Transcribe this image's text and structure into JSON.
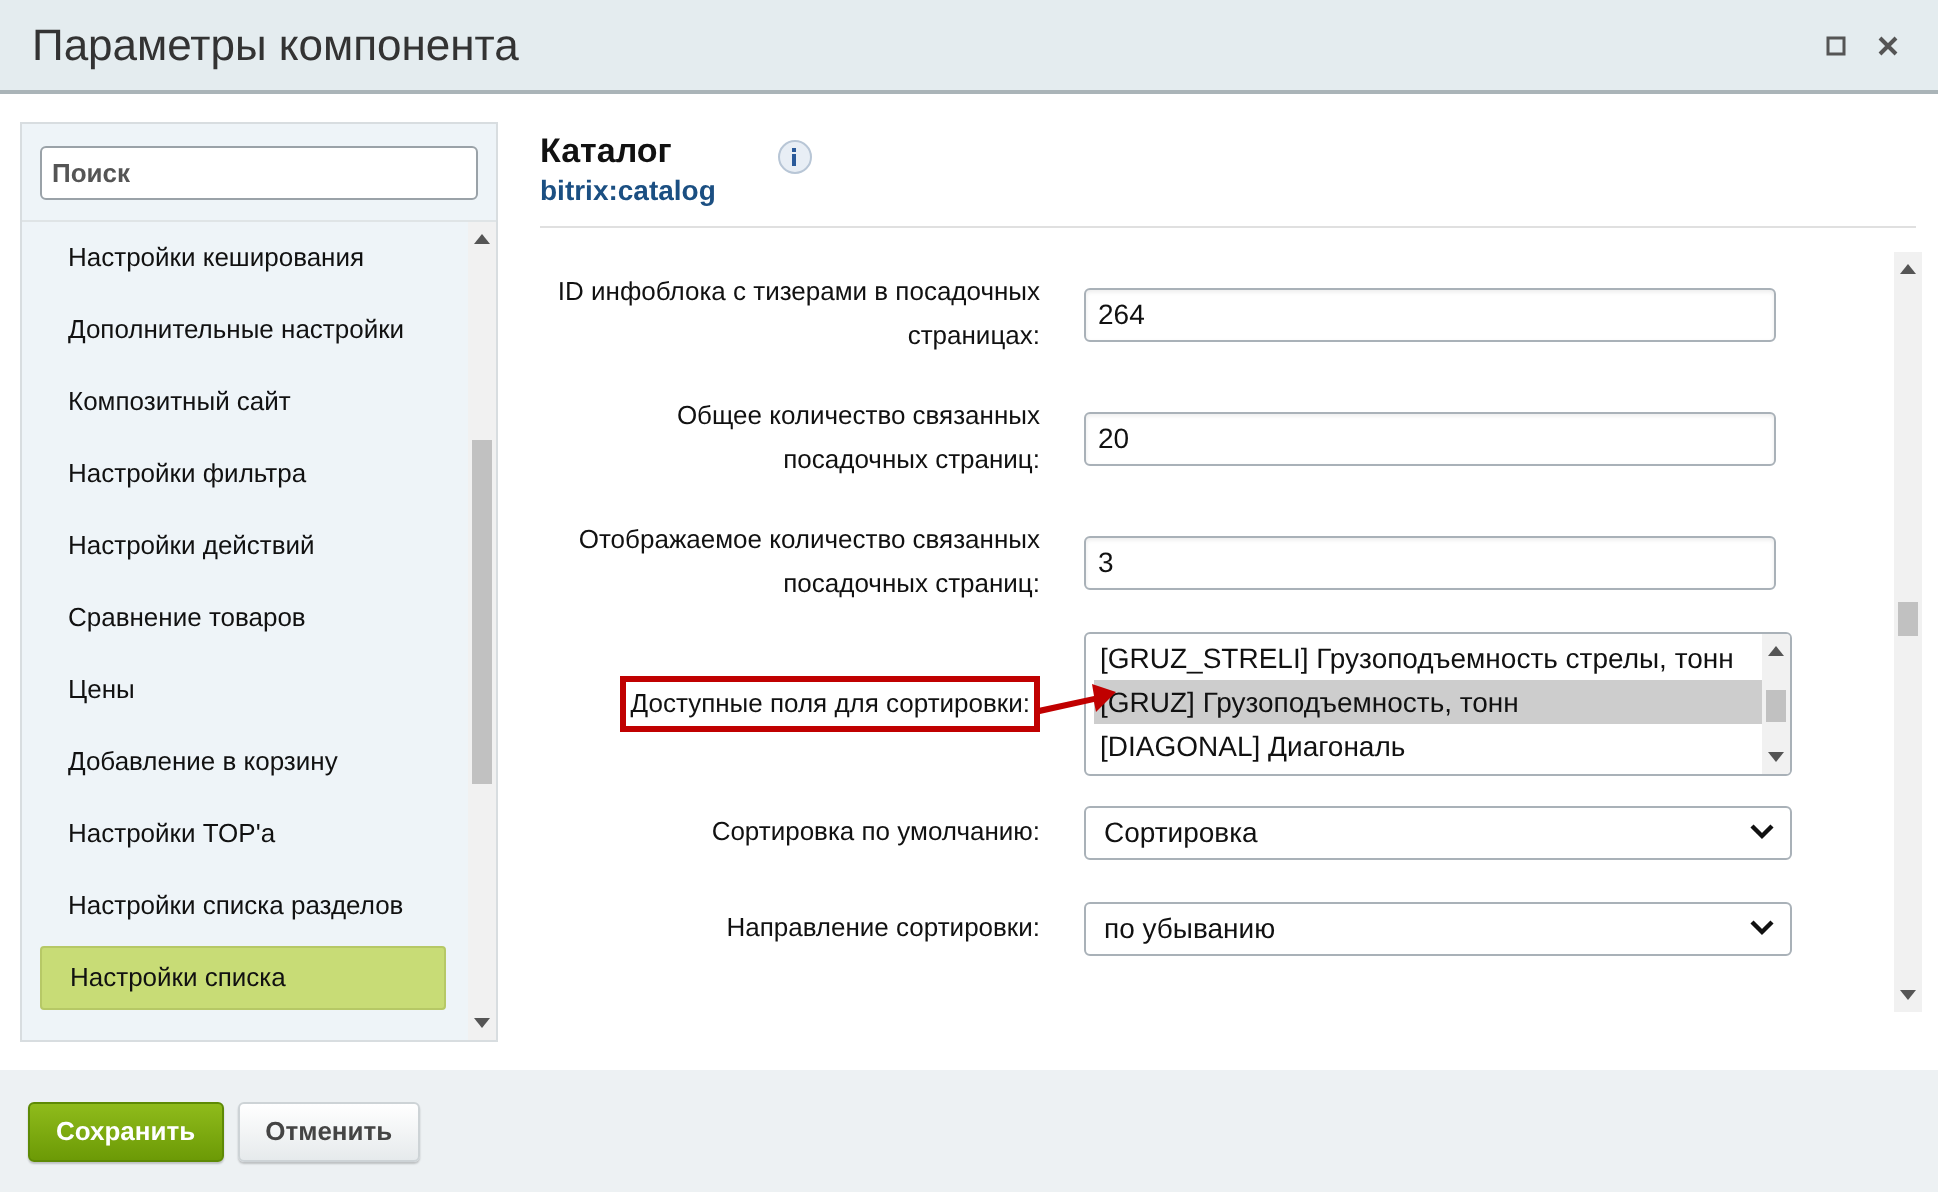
{
  "window": {
    "title": "Параметры компонента"
  },
  "sidebar": {
    "search": {
      "placeholder": "Поиск"
    },
    "items": [
      {
        "label": "Настройки кеширования",
        "selected": false
      },
      {
        "label": "Дополнительные настройки",
        "selected": false
      },
      {
        "label": "Композитный сайт",
        "selected": false
      },
      {
        "label": "Настройки фильтра",
        "selected": false
      },
      {
        "label": "Настройки действий",
        "selected": false
      },
      {
        "label": "Сравнение товаров",
        "selected": false
      },
      {
        "label": "Цены",
        "selected": false
      },
      {
        "label": "Добавление в корзину",
        "selected": false
      },
      {
        "label": "Настройки TOP'a",
        "selected": false
      },
      {
        "label": "Настройки списка разделов",
        "selected": false
      },
      {
        "label": "Настройки списка",
        "selected": true
      }
    ]
  },
  "component": {
    "title": "Каталог",
    "code": "bitrix:catalog"
  },
  "fields": [
    {
      "kind": "input",
      "label": "ID инфоблока с тизерами в посадочных страницах:",
      "value": "264"
    },
    {
      "kind": "input",
      "label": "Общее количество связанных посадочных страниц:",
      "value": "20"
    },
    {
      "kind": "input",
      "label": "Отображаемое количество связанных посадочных страниц:",
      "value": "3"
    },
    {
      "kind": "multiselect",
      "label": "Доступные поля для сортировки:",
      "highlighted": true,
      "options": [
        {
          "label": "[GRUZ_STRELI] Грузоподъемность стрелы, тонн",
          "selected": false
        },
        {
          "label": "[GRUZ] Грузоподъемность, тонн",
          "selected": true
        },
        {
          "label": "[DIAGONAL] Диагональ",
          "selected": false
        }
      ]
    },
    {
      "kind": "select",
      "label": "Сортировка по умолчанию:",
      "value": "Сортировка"
    },
    {
      "kind": "select",
      "label": "Направление сортировки:",
      "value": "по убыванию"
    }
  ],
  "buttons": [
    {
      "label": "Сохранить",
      "kind": "primary"
    },
    {
      "label": "Отменить",
      "kind": "secondary"
    }
  ]
}
